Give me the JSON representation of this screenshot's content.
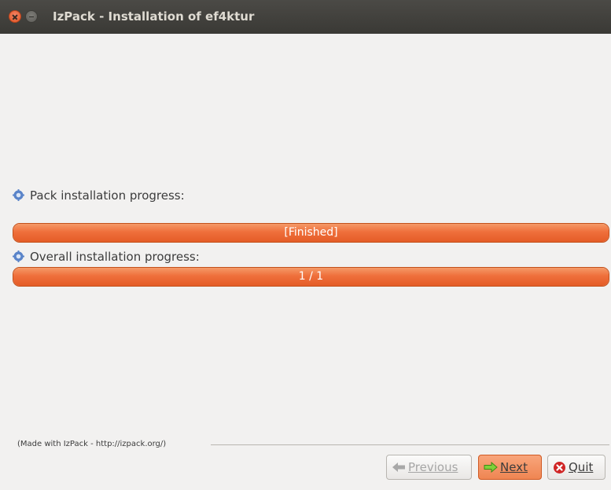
{
  "window": {
    "title": "IzPack - Installation of ef4ktur"
  },
  "progress": {
    "pack": {
      "label": "Pack installation progress:",
      "status_text": "[Finished]",
      "fraction": 1.0
    },
    "overall": {
      "label": "Overall installation progress:",
      "status_text": "1 / 1",
      "fraction": 1.0
    }
  },
  "footer": {
    "credit": "(Made with IzPack - http://izpack.org/)"
  },
  "buttons": {
    "previous": {
      "label": "Previous",
      "enabled": false,
      "icon": "arrow-left-icon"
    },
    "next": {
      "label": "Next",
      "enabled": true,
      "icon": "arrow-right-icon"
    },
    "quit": {
      "label": "Quit",
      "enabled": true,
      "icon": "close-circle-icon"
    }
  },
  "colors": {
    "accent": "#ef6f3b",
    "titlebar": "#3c3b37",
    "close": "#e2531f"
  }
}
